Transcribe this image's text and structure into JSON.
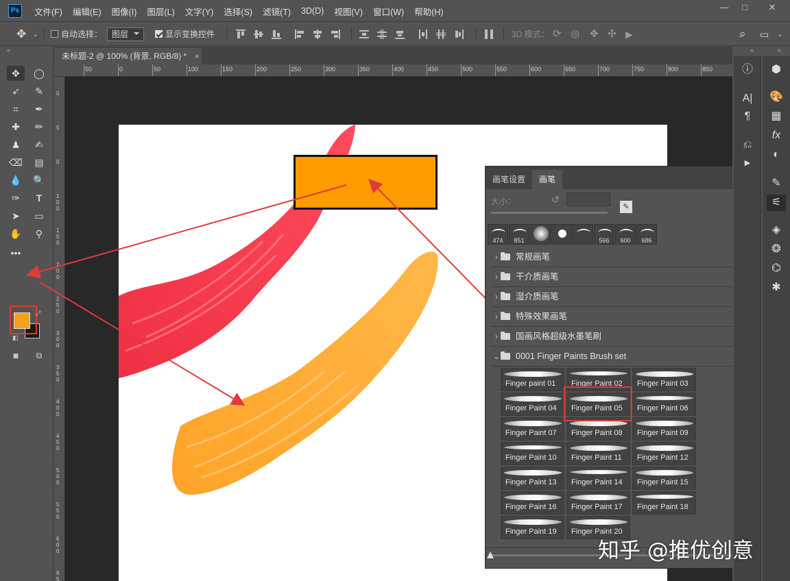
{
  "app": {
    "logo": "Ps"
  },
  "menu": [
    "文件(F)",
    "编辑(E)",
    "图像(I)",
    "图层(L)",
    "文字(Y)",
    "选择(S)",
    "滤镜(T)",
    "3D(D)",
    "视图(V)",
    "窗口(W)",
    "帮助(H)"
  ],
  "options": {
    "auto_select_label": "自动选择：",
    "auto_select_value": "图层",
    "show_transform_label": "显示变换控件",
    "mode_3d_label": "3D 模式："
  },
  "document": {
    "tab_title": "未标题-2 @ 100% (背景, RGB/8) *",
    "close": "×"
  },
  "ruler": {
    "h_ticks": [
      "50",
      "0",
      "50",
      "100",
      "150",
      "200",
      "250",
      "300",
      "350",
      "400",
      "450",
      "500",
      "550",
      "600",
      "650",
      "700",
      "750",
      "800",
      "850"
    ],
    "v_ticks": [
      "5",
      "0",
      "5",
      "0",
      "1\n0\n0",
      "1\n5\n0",
      "2\n0\n0",
      "2\n5\n0",
      "3\n0\n0",
      "3\n5\n0",
      "4\n0\n0",
      "4\n5\n0",
      "5\n0\n0",
      "5\n5\n0",
      "6\n0\n0",
      "6\n5\n0"
    ]
  },
  "colors": {
    "foreground": "#f5a01a",
    "background": "#1a1a1a",
    "accent_red": "#e03a3a",
    "swatch": "#ff9c00",
    "stroke_red": "#ef3b4a",
    "stroke_orange": "#ffab2e"
  },
  "brush_panel": {
    "tab_settings": "画笔设置",
    "tab_brush": "画笔",
    "size_label": "大小：",
    "expand": ">>",
    "menu": "≡",
    "presets": [
      {
        "size": "474"
      },
      {
        "size": "851"
      },
      {
        "size": ""
      },
      {
        "size": ""
      },
      {
        "size": ""
      },
      {
        "size": "566"
      },
      {
        "size": "600"
      },
      {
        "size": "686"
      }
    ],
    "folders": [
      {
        "label": "常规画笔",
        "expanded": false
      },
      {
        "label": "干介质画笔",
        "expanded": false
      },
      {
        "label": "湿介质画笔",
        "expanded": false
      },
      {
        "label": "特殊效果画笔",
        "expanded": false
      },
      {
        "label": "国画风格超级水墨笔刷",
        "expanded": false
      },
      {
        "label": "0001 Finger Paints Brush set",
        "expanded": true
      }
    ],
    "brushes": [
      "Finger paint 01",
      "Finger Paint 02",
      "Finger Paint 03",
      "Finger Paint 04",
      "Finger Paint 05",
      "Finger Paint 06",
      "Finger Paint 07",
      "Finger Paint 08",
      "Finger Paint 09",
      "Finger Paint 10",
      "Finger Paint 11",
      "Finger Paint 12",
      "Finger Paint 13",
      "Finger Paint 14",
      "Finger Paint 15",
      "Finger Paint 16",
      "Finger Paint 17",
      "Finger Paint 18",
      "Finger Paint 19",
      "Finger Paint 20"
    ],
    "selected_brush": "Finger Paint 05"
  },
  "watermark": "知乎 @推优创意"
}
